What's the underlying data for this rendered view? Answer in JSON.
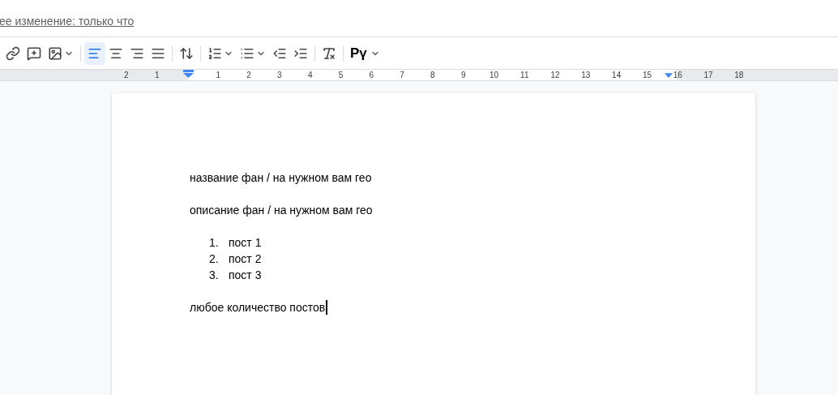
{
  "last_edit_link": "ее изменение: только что",
  "toolbar": [
    {
      "kind": "link"
    },
    {
      "kind": "comment"
    },
    {
      "kind": "image",
      "dropdown": true
    },
    {
      "kind": "separator"
    },
    {
      "kind": "align-left",
      "selected": true
    },
    {
      "kind": "align-center",
      "selected": false
    },
    {
      "kind": "align-right",
      "selected": false
    },
    {
      "kind": "align-justify",
      "selected": false
    },
    {
      "kind": "separator"
    },
    {
      "kind": "line-spacing"
    },
    {
      "kind": "separator"
    },
    {
      "kind": "numbered-list",
      "dropdown": true
    },
    {
      "kind": "bulleted-list",
      "dropdown": true
    },
    {
      "kind": "indent-decrease"
    },
    {
      "kind": "indent-increase"
    },
    {
      "kind": "separator"
    },
    {
      "kind": "clear-formatting"
    },
    {
      "kind": "separator"
    },
    {
      "kind": "input-tools",
      "label": "Pү",
      "dropdown": true
    }
  ],
  "ruler": {
    "labels_before": [
      "2",
      "1"
    ],
    "labels_after": [
      "1",
      "2",
      "3",
      "4",
      "5",
      "6",
      "7",
      "8",
      "9",
      "10",
      "11",
      "12",
      "13",
      "14",
      "15",
      "16",
      "17",
      "18"
    ]
  },
  "document": [
    {
      "kind": "paragraph",
      "text": "название фан / на нужном вам гео"
    },
    {
      "kind": "paragraph",
      "text": "описание фан / на нужном вам гео"
    },
    {
      "kind": "list",
      "items": [
        {
          "number": "1.",
          "text": "пост 1"
        },
        {
          "number": "2.",
          "text": "пост 2"
        },
        {
          "number": "3.",
          "text": "пост 3"
        }
      ]
    },
    {
      "kind": "paragraph",
      "text": "любое количество постов",
      "cursor": true
    }
  ]
}
